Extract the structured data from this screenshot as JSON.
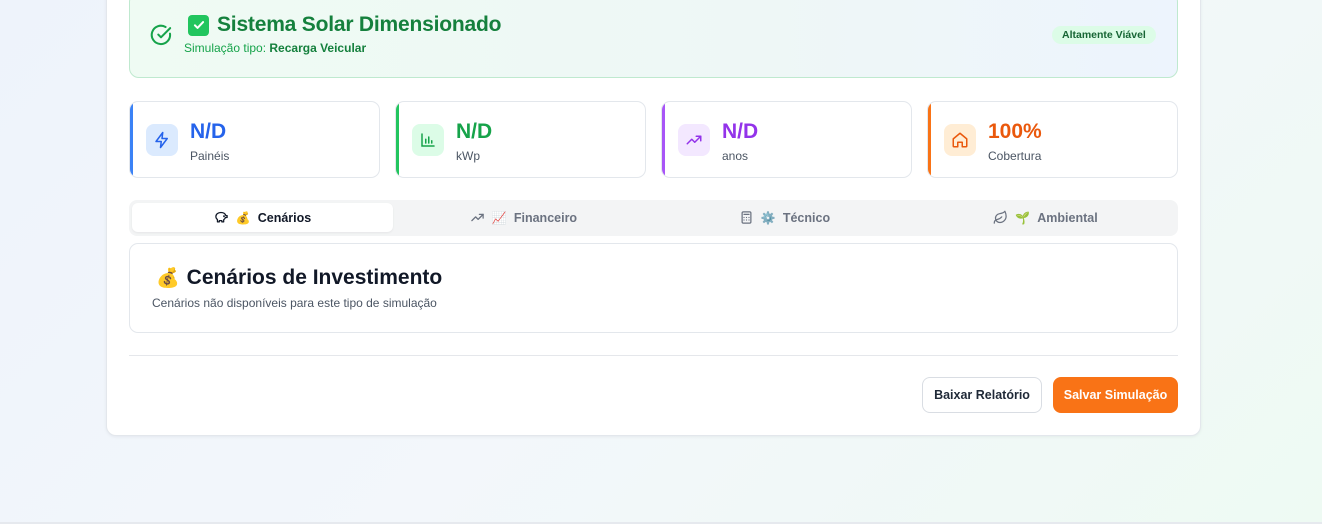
{
  "banner": {
    "title": "Sistema Solar Dimensionado",
    "subtitle_prefix": "Simulação tipo:",
    "subtitle_value": "Recarga Veicular",
    "badge": "Altamente Viável"
  },
  "metrics": [
    {
      "value": "N/D",
      "label": "Painéis",
      "icon": "zap-icon",
      "color": "#2563eb"
    },
    {
      "value": "N/D",
      "label": "kWp",
      "icon": "bar-chart-icon",
      "color": "#16a34a"
    },
    {
      "value": "N/D",
      "label": "anos",
      "icon": "trending-up-icon",
      "color": "#9333ea"
    },
    {
      "value": "100%",
      "label": "Cobertura",
      "icon": "home-icon",
      "color": "#ea580c"
    }
  ],
  "tabs": [
    {
      "label": "Cenários",
      "emoji": "💰",
      "icon": "piggy-bank-icon",
      "active": true
    },
    {
      "label": "Financeiro",
      "emoji": "📈",
      "icon": "trending-up-icon",
      "active": false
    },
    {
      "label": "Técnico",
      "emoji": "⚙️",
      "icon": "calculator-icon",
      "active": false
    },
    {
      "label": "Ambiental",
      "emoji": "🌱",
      "icon": "leaf-icon",
      "active": false
    }
  ],
  "panel": {
    "emoji": "💰",
    "title": "Cenários de Investimento",
    "description": "Cenários não disponíveis para este tipo de simulação"
  },
  "actions": {
    "download_label": "Baixar Relatório",
    "save_label": "Salvar Simulação"
  }
}
